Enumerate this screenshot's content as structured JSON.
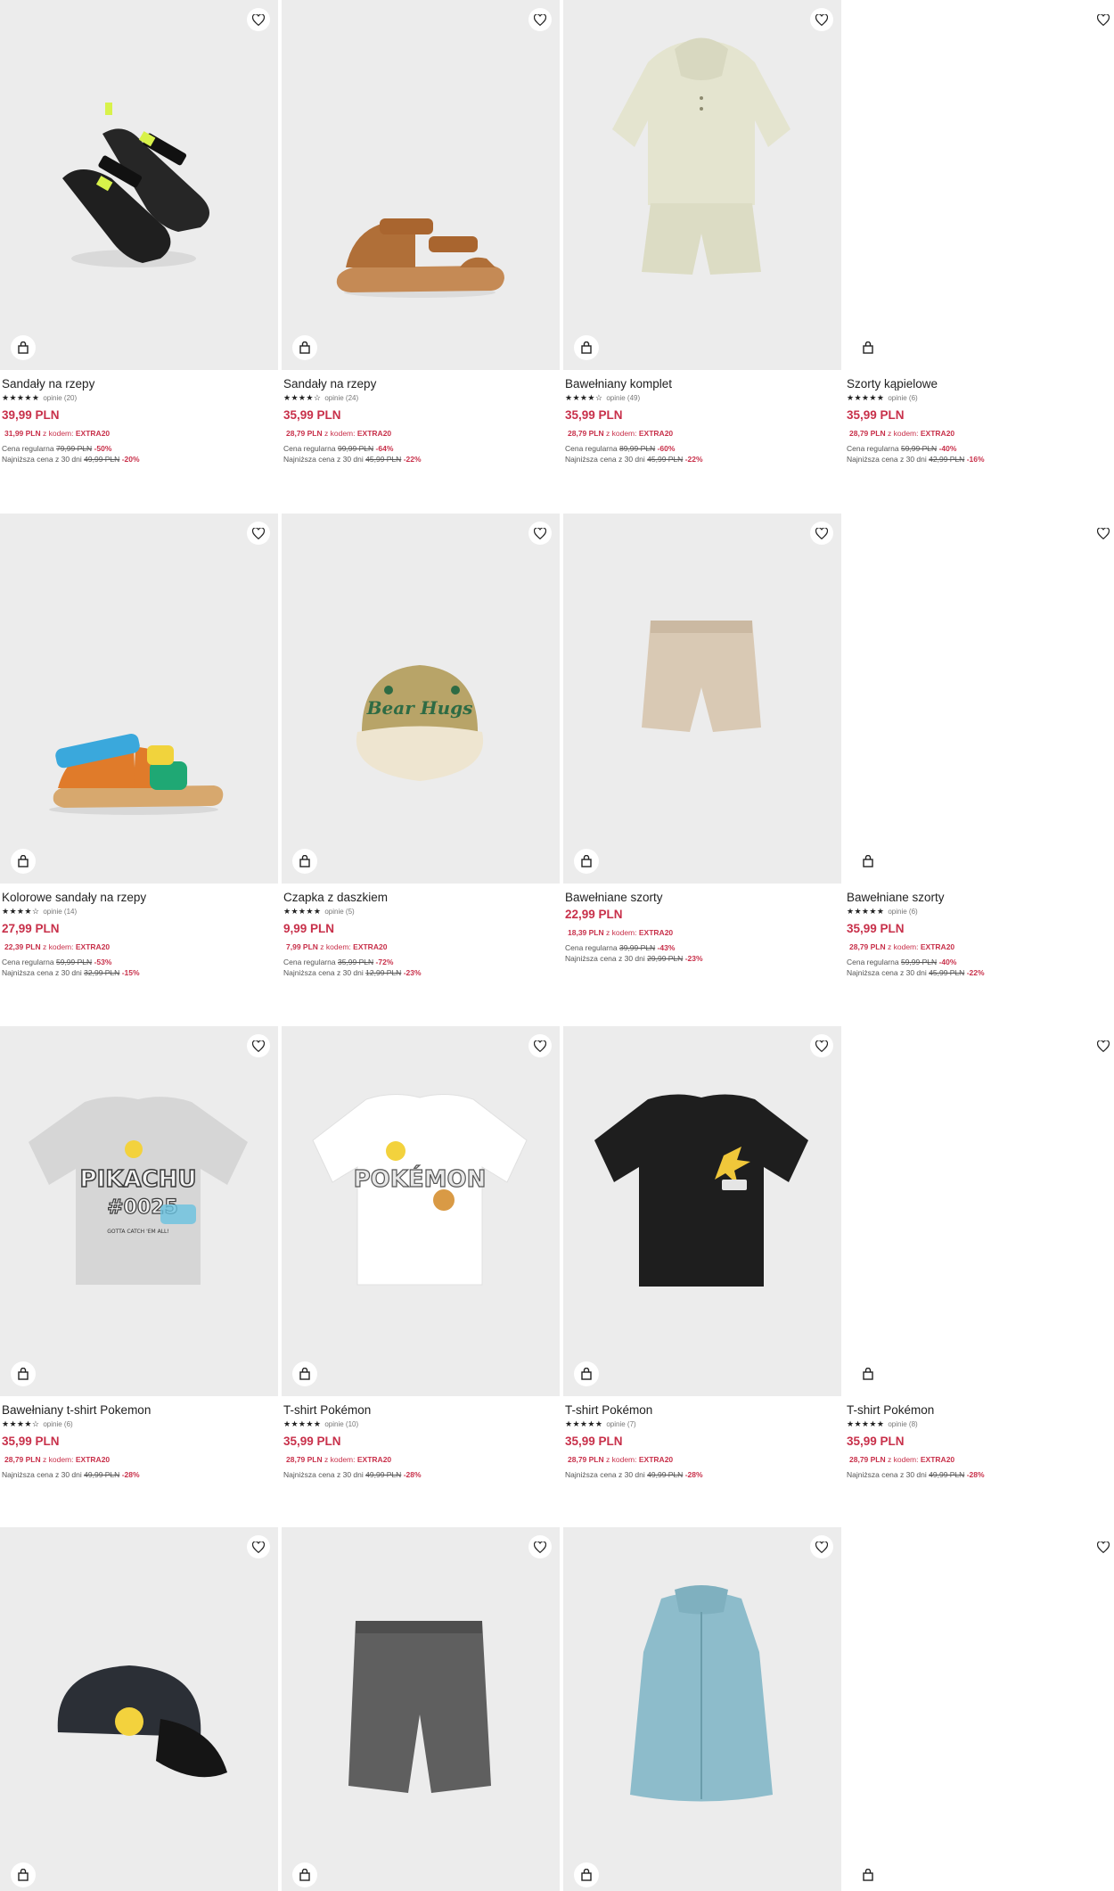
{
  "ui": {
    "accent": "#c8304a",
    "favorite_icon": "heart-icon",
    "cart_icon": "shopping-bag-icon"
  },
  "products": [
    {
      "name": "Sandały na rzepy",
      "stars": "★★★★★",
      "reviews": "opinie (20)",
      "price": "39,99 PLN",
      "code_price": "31,99 PLN",
      "code_label": "z kodem:",
      "code": "EXTRA20",
      "reg_label": "Cena regularna",
      "reg_price": "79,99 PLN",
      "reg_pct": "-50%",
      "low_label": "Najniższa cena z 30 dni",
      "low_price": "49,99 PLN",
      "low_pct": "-20%"
    },
    {
      "name": "Sandały na rzepy",
      "stars": "★★★★☆",
      "reviews": "opinie (24)",
      "price": "35,99 PLN",
      "code_price": "28,79 PLN",
      "code_label": "z kodem:",
      "code": "EXTRA20",
      "reg_label": "Cena regularna",
      "reg_price": "99,99 PLN",
      "reg_pct": "-64%",
      "low_label": "Najniższa cena z 30 dni",
      "low_price": "45,99 PLN",
      "low_pct": "-22%"
    },
    {
      "name": "Bawełniany komplet",
      "stars": "★★★★☆",
      "reviews": "opinie (49)",
      "price": "35,99 PLN",
      "code_price": "28,79 PLN",
      "code_label": "z kodem:",
      "code": "EXTRA20",
      "reg_label": "Cena regularna",
      "reg_price": "89,99 PLN",
      "reg_pct": "-60%",
      "low_label": "Najniższa cena z 30 dni",
      "low_price": "45,99 PLN",
      "low_pct": "-22%"
    },
    {
      "name": "Szorty kąpielowe",
      "stars": "★★★★★",
      "reviews": "opinie (6)",
      "price": "35,99 PLN",
      "code_price": "28,79 PLN",
      "code_label": "z kodem:",
      "code": "EXTRA20",
      "reg_label": "Cena regularna",
      "reg_price": "59,99 PLN",
      "reg_pct": "-40%",
      "low_label": "Najniższa cena z 30 dni",
      "low_price": "42,99 PLN",
      "low_pct": "-16%"
    },
    {
      "name": "Kolorowe sandały na rzepy",
      "stars": "★★★★☆",
      "reviews": "opinie (14)",
      "price": "27,99 PLN",
      "code_price": "22,39 PLN",
      "code_label": "z kodem:",
      "code": "EXTRA20",
      "reg_label": "Cena regularna",
      "reg_price": "59,99 PLN",
      "reg_pct": "-53%",
      "low_label": "Najniższa cena z 30 dni",
      "low_price": "32,99 PLN",
      "low_pct": "-15%"
    },
    {
      "name": "Czapka z daszkiem",
      "stars": "★★★★★",
      "reviews": "opinie (5)",
      "price": "9,99 PLN",
      "code_price": "7,99 PLN",
      "code_label": "z kodem:",
      "code": "EXTRA20",
      "reg_label": "Cena regularna",
      "reg_price": "35,99 PLN",
      "reg_pct": "-72%",
      "low_label": "Najniższa cena z 30 dni",
      "low_price": "12,99 PLN",
      "low_pct": "-23%"
    },
    {
      "name": "Bawełniane szorty",
      "stars": "",
      "reviews": "",
      "price": "22,99 PLN",
      "code_price": "18,39 PLN",
      "code_label": "z kodem:",
      "code": "EXTRA20",
      "reg_label": "Cena regularna",
      "reg_price": "39,99 PLN",
      "reg_pct": "-43%",
      "low_label": "Najniższa cena z 30 dni",
      "low_price": "29,99 PLN",
      "low_pct": "-23%"
    },
    {
      "name": "Bawełniane szorty",
      "stars": "★★★★★",
      "reviews": "opinie (6)",
      "price": "35,99 PLN",
      "code_price": "28,79 PLN",
      "code_label": "z kodem:",
      "code": "EXTRA20",
      "reg_label": "Cena regularna",
      "reg_price": "59,99 PLN",
      "reg_pct": "-40%",
      "low_label": "Najniższa cena z 30 dni",
      "low_price": "45,99 PLN",
      "low_pct": "-22%"
    },
    {
      "name": "Bawełniany t-shirt Pokemon",
      "stars": "★★★★☆",
      "reviews": "opinie (6)",
      "price": "35,99 PLN",
      "code_price": "28,79 PLN",
      "code_label": "z kodem:",
      "code": "EXTRA20",
      "reg_label": "",
      "reg_price": "",
      "reg_pct": "",
      "low_label": "Najniższa cena z 30 dni",
      "low_price": "49,99 PLN",
      "low_pct": "-28%"
    },
    {
      "name": "T-shirt Pokémon",
      "stars": "★★★★★",
      "reviews": "opinie (10)",
      "price": "35,99 PLN",
      "code_price": "28,79 PLN",
      "code_label": "z kodem:",
      "code": "EXTRA20",
      "reg_label": "",
      "reg_price": "",
      "reg_pct": "",
      "low_label": "Najniższa cena z 30 dni",
      "low_price": "49,99 PLN",
      "low_pct": "-28%"
    },
    {
      "name": "T-shirt Pokémon",
      "stars": "★★★★★",
      "reviews": "opinie (7)",
      "price": "35,99 PLN",
      "code_price": "28,79 PLN",
      "code_label": "z kodem:",
      "code": "EXTRA20",
      "reg_label": "",
      "reg_price": "",
      "reg_pct": "",
      "low_label": "Najniższa cena z 30 dni",
      "low_price": "49,99 PLN",
      "low_pct": "-28%"
    },
    {
      "name": "T-shirt Pokémon",
      "stars": "★★★★★",
      "reviews": "opinie (8)",
      "price": "35,99 PLN",
      "code_price": "28,79 PLN",
      "code_label": "z kodem:",
      "code": "EXTRA20",
      "reg_label": "",
      "reg_price": "",
      "reg_pct": "",
      "low_label": "Najniższa cena z 30 dni",
      "low_price": "49,99 PLN",
      "low_pct": "-28%"
    }
  ],
  "image_only_cards": 4,
  "printed_graphics": {
    "pikachu_tee": [
      "PIKACHU",
      "#0025",
      "GOTTA CATCH 'EM ALL!"
    ],
    "pokemon_tee": [
      "POKÉMON"
    ],
    "cap": [
      "Bear Hugs"
    ]
  }
}
